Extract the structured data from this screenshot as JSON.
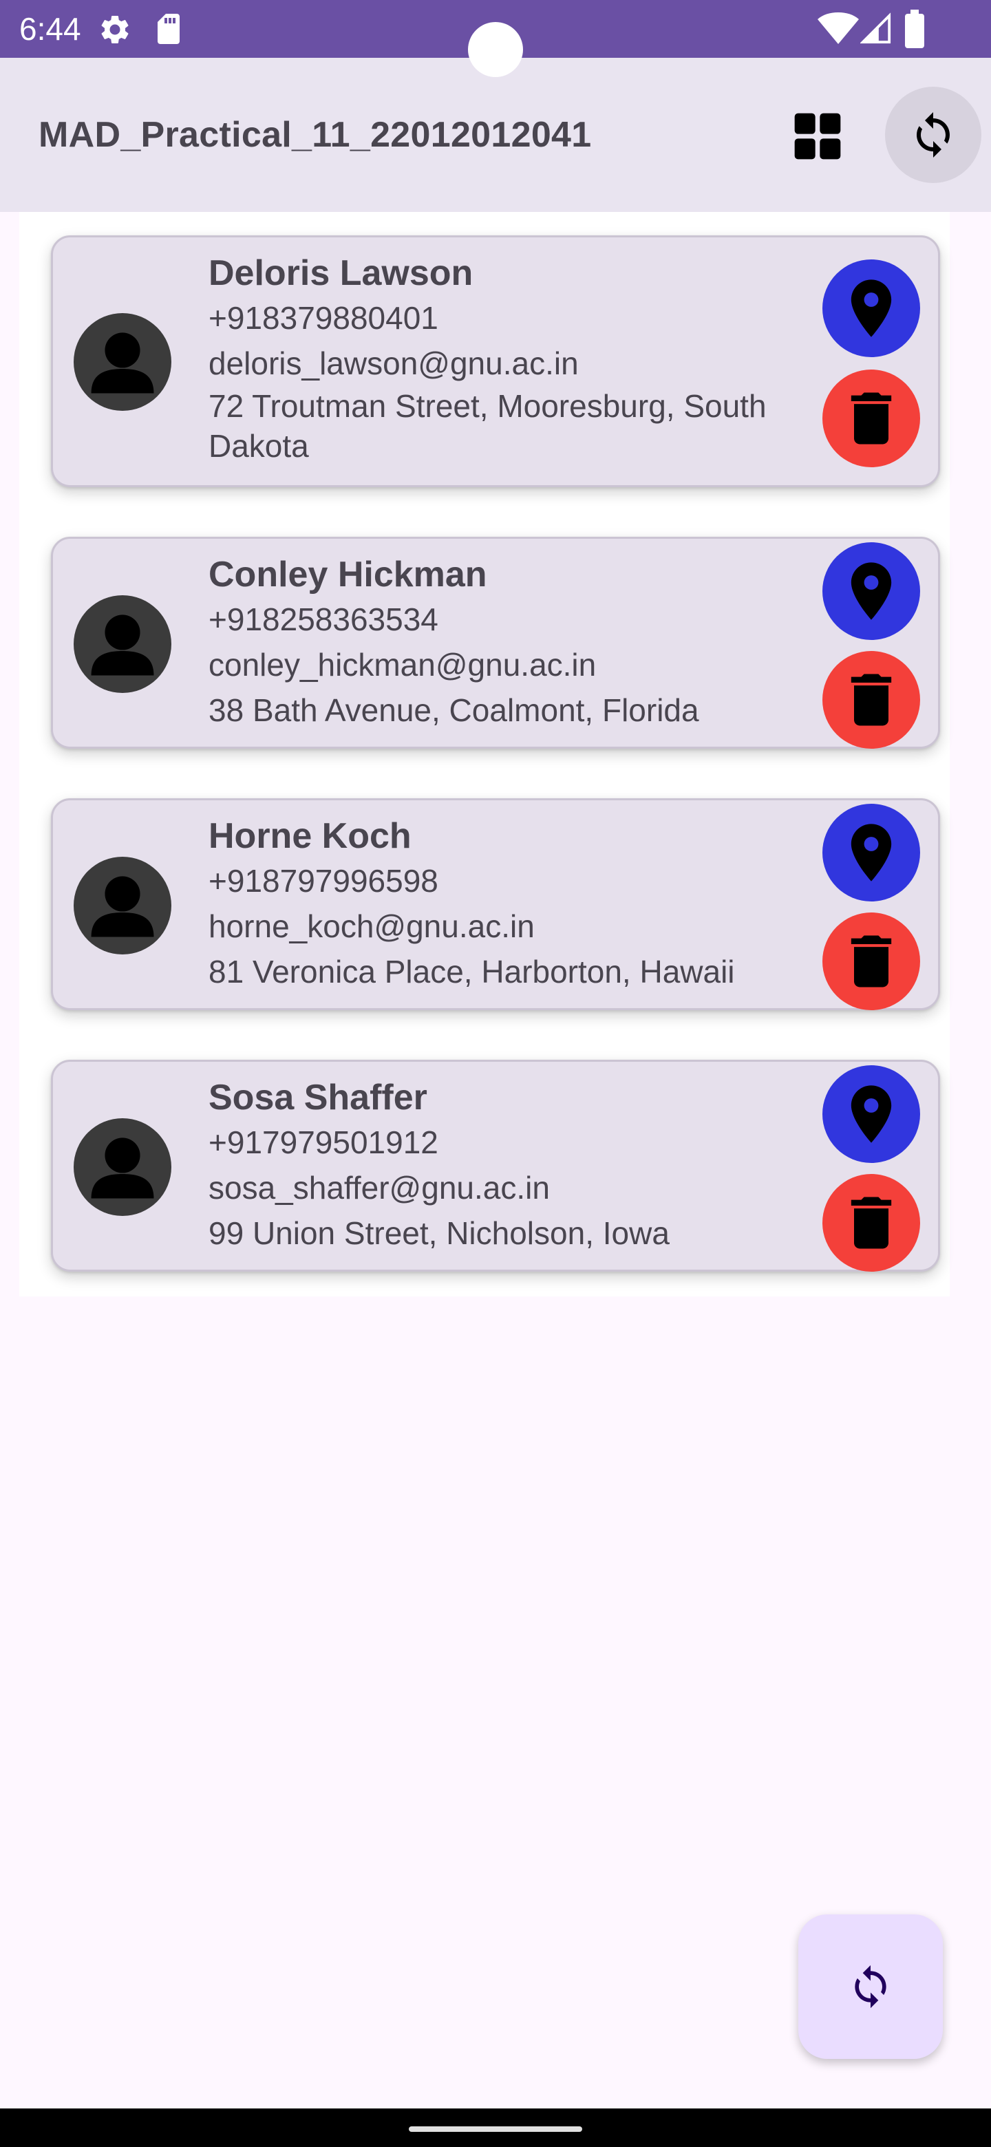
{
  "status_bar": {
    "time": "6:44"
  },
  "app_bar": {
    "title": "MAD_Practical_11_22012012041"
  },
  "contacts": [
    {
      "name": "Deloris Lawson",
      "phone": "+918379880401",
      "email": "deloris_lawson@gnu.ac.in",
      "address": "72 Troutman Street, Mooresburg, South Dakota"
    },
    {
      "name": "Conley Hickman",
      "phone": "+918258363534",
      "email": "conley_hickman@gnu.ac.in",
      "address": "38 Bath Avenue, Coalmont, Florida"
    },
    {
      "name": "Horne Koch",
      "phone": "+918797996598",
      "email": "horne_koch@gnu.ac.in",
      "address": "81 Veronica Place, Harborton, Hawaii"
    },
    {
      "name": "Sosa Shaffer",
      "phone": "+917979501912",
      "email": "sosa_shaffer@gnu.ac.in",
      "address": "99 Union Street, Nicholson, Iowa"
    }
  ],
  "colors": {
    "status_bar": "#6a50a4",
    "app_bar": "#e9e4f0",
    "card": "#e6e0ec",
    "location_button": "#3136de",
    "delete_button": "#f4403a",
    "fab": "#eaddff"
  },
  "icons": {
    "status": [
      "gear-icon",
      "sd-card-icon",
      "wifi-icon",
      "signal-icon",
      "battery-icon"
    ],
    "app_bar": [
      "grid-view-icon",
      "refresh-icon"
    ],
    "card": [
      "person-icon",
      "location-pin-icon",
      "trash-icon"
    ],
    "fab": "refresh-icon"
  }
}
